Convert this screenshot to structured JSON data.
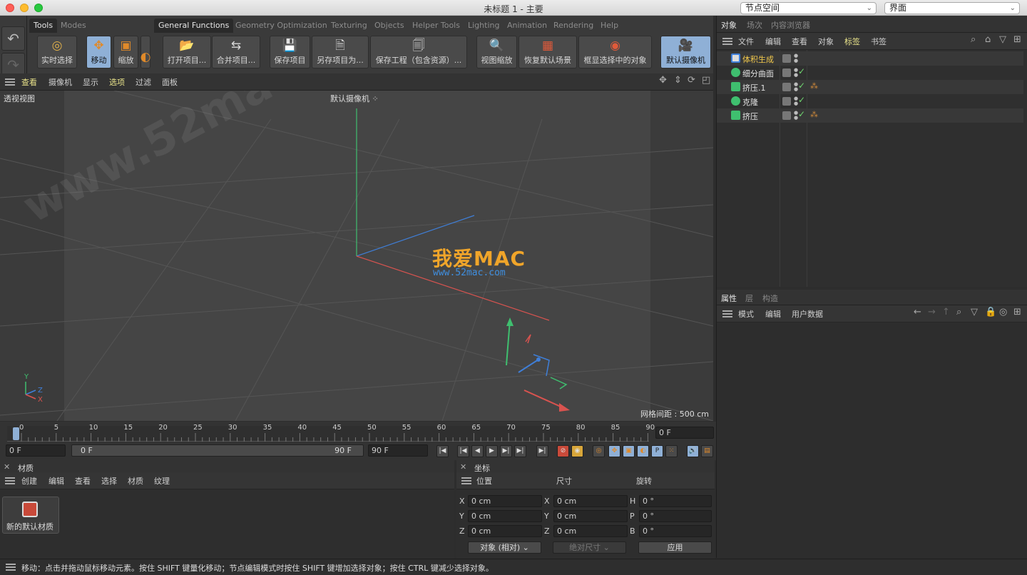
{
  "window": {
    "title": "未标题 1 - 主要",
    "node_space_select": "节点空间",
    "layout_select": "界面"
  },
  "toolbar": {
    "tabs": [
      "Tools",
      "Modes",
      "General Functions",
      "Geometry Optimization",
      "Texturing",
      "Objects",
      "Helper Tools",
      "Lighting",
      "Animation",
      "Rendering",
      "Help"
    ],
    "buttons": {
      "live_select": "实时选择",
      "move": "移动",
      "scale": "缩放",
      "open_project": "打开项目...",
      "merge_project": "合并项目...",
      "save_project": "保存项目",
      "save_project_as": "另存项目为...",
      "save_project_assets": "保存工程（包含资源）...",
      "view_zoom": "视图缩放",
      "restore_default_scene": "恢复默认场景",
      "frame_selected": "框显选择中的对象",
      "default_camera": "默认摄像机"
    }
  },
  "viewport": {
    "menu": [
      "查看",
      "摄像机",
      "显示",
      "选项",
      "过滤",
      "面板"
    ],
    "selected_menu": "选项",
    "view_name": "透视视图",
    "camera_label": "默认摄像机",
    "grid_spacing": "网格间距 : 500 cm",
    "watermark_main": "我爱MAC",
    "watermark_url": "www.52mac.com",
    "watermark_diag": "www.52mac.com",
    "axis_y": "Y",
    "axis_z": "Z",
    "axis_x": "X"
  },
  "timeline": {
    "ticks": [
      "0",
      "5",
      "10",
      "15",
      "20",
      "25",
      "30",
      "35",
      "40",
      "45",
      "50",
      "55",
      "60",
      "65",
      "70",
      "75",
      "80",
      "85",
      "90"
    ],
    "current_frame_right": "0 F",
    "start_frame": "0 F",
    "range_start": "0 F",
    "range_end": "90 F",
    "end_frame": "90 F"
  },
  "materials": {
    "title": "材质",
    "menu": [
      "创建",
      "编辑",
      "查看",
      "选择",
      "材质",
      "纹理"
    ],
    "item_label": "新的默认材质"
  },
  "coordinates": {
    "title": "坐标",
    "headers": {
      "position": "位置",
      "size": "尺寸",
      "rotation": "旋转"
    },
    "rows": [
      {
        "axis": "X",
        "pos": "0 cm",
        "size_axis": "X",
        "size": "0 cm",
        "rot_axis": "H",
        "rot": "0 °"
      },
      {
        "axis": "Y",
        "pos": "0 cm",
        "size_axis": "Y",
        "size": "0 cm",
        "rot_axis": "P",
        "rot": "0 °"
      },
      {
        "axis": "Z",
        "pos": "0 cm",
        "size_axis": "Z",
        "size": "0 cm",
        "rot_axis": "B",
        "rot": "0 °"
      }
    ],
    "mode_select": "对象 (相对)",
    "size_mode_select": "绝对尺寸",
    "apply_button": "应用"
  },
  "objects_panel": {
    "tabs": [
      "对象",
      "场次",
      "内容浏览器"
    ],
    "menu": [
      "文件",
      "编辑",
      "查看",
      "对象",
      "标签",
      "书签"
    ],
    "selected_menu": "标签",
    "objects": [
      {
        "name": "体积生成",
        "highlight": true
      },
      {
        "name": "细分曲面",
        "highlight": false
      },
      {
        "name": "挤压.1",
        "highlight": false
      },
      {
        "name": "克隆",
        "highlight": false
      },
      {
        "name": "挤压",
        "highlight": false
      }
    ]
  },
  "attributes_panel": {
    "tabs": [
      "属性",
      "层",
      "构造"
    ],
    "menu": [
      "模式",
      "编辑",
      "用户数据"
    ]
  },
  "status_text": "移动：点击并拖动鼠标移动元素。按住 SHIFT 键量化移动；节点编辑模式时按住 SHIFT 键增加选择对象；按住 CTRL 键减少选择对象。",
  "colors": {
    "accent_blue": "#8fb0d6",
    "highlight_yellow": "#f2c94c",
    "check_green": "#6fd46f",
    "axis_x": "#d9534f",
    "axis_y": "#3fbf6f",
    "axis_z": "#3f7fd9"
  }
}
